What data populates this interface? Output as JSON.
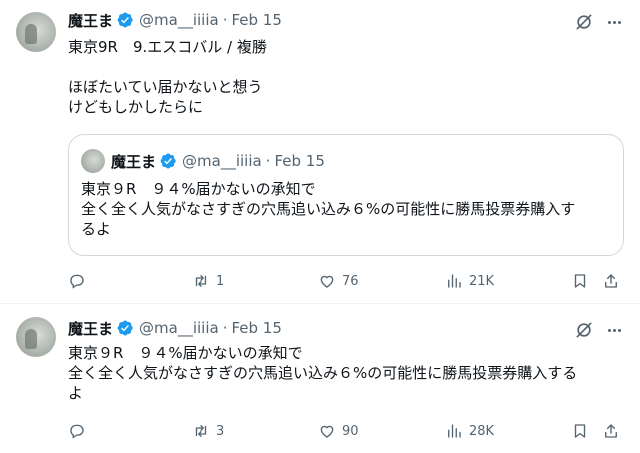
{
  "tweets": [
    {
      "name": "魔王ま",
      "handle": "@ma__iiiia",
      "dot": "·",
      "date": "Feb 15",
      "text": "東京9R　9.エスコバル / 複勝\n\nほぼたいてい届かないと想う\nけどもしかしたらに",
      "quote": {
        "name": "魔王ま",
        "handle": "@ma__iiiia",
        "dot": "·",
        "date": "Feb 15",
        "text": "東京９R　９４%届かないの承知で\n全く全く人気がなさすぎの穴馬追い込み６%の可能性に勝馬投票券購入す\nるよ"
      },
      "stats": {
        "replies": "",
        "reposts": "1",
        "likes": "76",
        "views": "21K"
      }
    },
    {
      "name": "魔王ま",
      "handle": "@ma__iiiia",
      "dot": "·",
      "date": "Feb 15",
      "text": "東京９R　９４%届かないの承知で\n全く全く人気がなさすぎの穴馬追い込み６%の可能性に勝馬投票券購入する\nよ",
      "stats": {
        "replies": "",
        "reposts": "3",
        "likes": "90",
        "views": "28K"
      }
    }
  ],
  "icons": {
    "verified": "verified-badge-icon",
    "grok": "grok-icon",
    "more": "more-icon",
    "reply": "reply-icon",
    "repost": "repost-icon",
    "like": "like-icon",
    "views": "views-icon",
    "bookmark": "bookmark-icon",
    "share": "share-icon"
  },
  "colors": {
    "verified": "#1d9bf0",
    "muted": "#536471",
    "text": "#0f1419",
    "border": "#cfd9de"
  }
}
